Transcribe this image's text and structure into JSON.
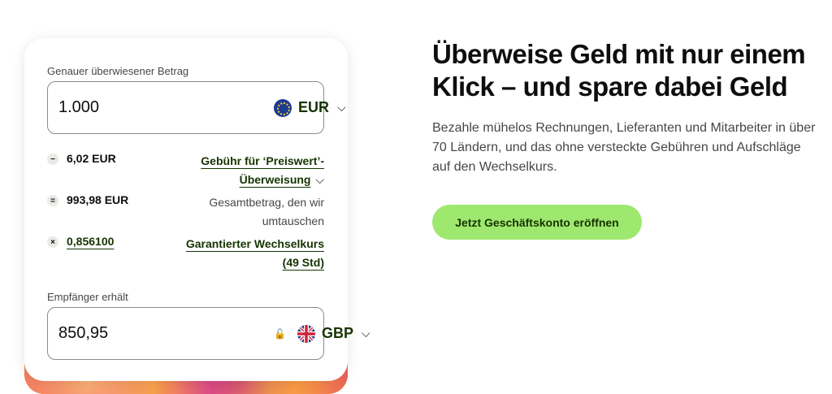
{
  "calculator": {
    "send_label": "Genauer überwiesener Betrag",
    "send_value": "1.000",
    "send_currency": "EUR",
    "fee_amount": "6,02 EUR",
    "fee_link_line1": "Gebühr für ‘Preiswert’-",
    "fee_link_line2": "Überweisung",
    "total_amount": "993,98 EUR",
    "total_label_line1": "Gesamtbetrag, den wir",
    "total_label_line2": "umtauschen",
    "rate_value": "0,856100",
    "rate_label_line1": "Garantierter Wechselkurs",
    "rate_label_line2": "(49 Std)",
    "receive_label": "Empfänger erhält",
    "receive_value": "850,95",
    "receive_currency": "GBP",
    "op_minus": "−",
    "op_equals": "=",
    "op_times": "×",
    "chevron": "⌵",
    "lock": "🔓"
  },
  "hero": {
    "heading": "Überweise Geld mit nur einem Klick – und spare dabei Geld",
    "description": "Bezahle mühelos Rechnungen, Lieferanten und Mitarbeiter in über 70 Ländern, und das ohne versteckte Gebühren und Aufschläge auf den Wechselkurs.",
    "cta_label": "Jetzt Geschäftskonto eröffnen"
  },
  "colors": {
    "accent": "#9fe870",
    "dark_green": "#163300",
    "text": "#0e0f0c",
    "muted": "#454745"
  }
}
